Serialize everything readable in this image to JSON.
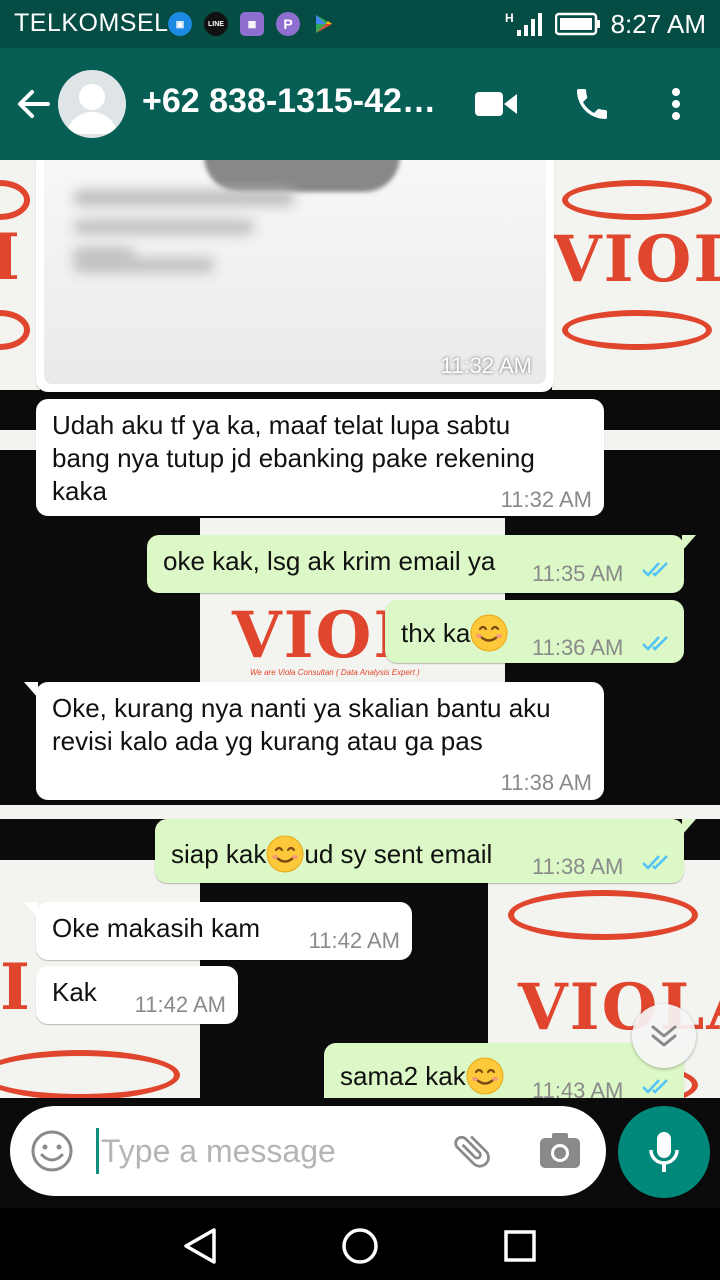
{
  "status_bar": {
    "carrier": "TELKOMSEL",
    "network": "H",
    "time": "8:27 AM",
    "notification_icons": [
      "bbm-icon",
      "line-today-icon",
      "gallery-icon",
      "p-app-icon",
      "play-store-icon"
    ]
  },
  "header": {
    "contact": "+62 838-1315-42…",
    "color": "#075e54"
  },
  "messages": [
    {
      "type": "image",
      "direction": "in",
      "time": "11:32 AM"
    },
    {
      "type": "text",
      "direction": "in",
      "text": "Udah aku tf ya ka, maaf telat lupa sabtu\nbang nya tutup jd ebanking pake rekening\nkaka",
      "time": "11:32 AM"
    },
    {
      "type": "text",
      "direction": "out",
      "text": "oke kak, lsg ak krim email ya",
      "time": "11:35 AM",
      "status": "read"
    },
    {
      "type": "text",
      "direction": "out",
      "text": "thx ka",
      "emoji": "smiling-face",
      "time": "11:36 AM",
      "status": "read"
    },
    {
      "type": "text",
      "direction": "in",
      "text": "Oke, kurang nya nanti ya skalian bantu aku\nrevisi kalo ada yg kurang atau ga pas",
      "time": "11:38 AM"
    },
    {
      "type": "text",
      "direction": "out",
      "text_before": "siap kak",
      "emoji": "smiling-face",
      "text_after": "ud sy sent email",
      "time": "11:38 AM",
      "status": "read"
    },
    {
      "type": "text",
      "direction": "in",
      "text": "Oke makasih kam",
      "time": "11:42 AM"
    },
    {
      "type": "text",
      "direction": "in",
      "text": "Kak",
      "time": "11:42 AM"
    },
    {
      "type": "text",
      "direction": "out",
      "text": "sama2 kak",
      "emoji": "smiling-face",
      "time": "11:43 AM",
      "status": "read"
    }
  ],
  "wallpaper": {
    "brand": "VIOLA",
    "tagline": "We are Viola Consultan ( Data Analysis Expert )"
  },
  "composer": {
    "placeholder": "Type a message"
  },
  "colors": {
    "accent": "#00897b",
    "outgoing_bubble": "#dcf8c6",
    "incoming_bubble": "#ffffff",
    "read_ticks": "#4fc3f7"
  }
}
